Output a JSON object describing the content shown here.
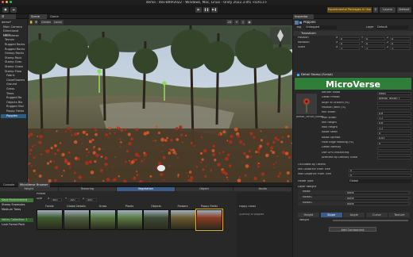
{
  "window": {
    "title": "demo - dev-BIRP2022 - Windows, Mac, Linux - Unity 2022.3.0f1 <DX11>"
  },
  "toolbar": {
    "experimental_label": "Experimental Packages In Use",
    "layers_label": "Layers",
    "layout_label": "Default"
  },
  "hierarchy": {
    "tab": "",
    "items": [
      "demo*",
      "Main Camera",
      "Directional Light",
      "MicroVerse",
      "Terrain",
      "Rugged Rocks",
      "Rugged Rocks",
      "Grassy Rocks",
      "Stamp Rock",
      "Stamp Gras",
      "Stamp Grass",
      "Stamp Flow",
      "Fabric",
      "ClearFlowers",
      "Ground",
      "Grass",
      "Trees",
      "Rugged Ro",
      "Objects Blo",
      "Rugged Stal",
      "Poppy Fields",
      "Poppies"
    ],
    "selected_index": 21
  },
  "scene": {
    "tabs": [
      "Scene",
      "Game"
    ],
    "toolbar_items": [
      "Center",
      "Local"
    ]
  },
  "inspector": {
    "tab": "Inspector",
    "object_name": "Poppies",
    "tag_label": "Tag",
    "tag_value": "Untagged",
    "layer_label": "Layer",
    "layer_value": "Default",
    "transform_header": "Transform",
    "position_label": "Position",
    "rotation_label": "Rotation",
    "scale_label": "Scale",
    "x": "X",
    "y": "Y",
    "z": "Z",
    "position": [
      "0",
      "0",
      "0"
    ],
    "rotation": [
      "0",
      "0",
      "0"
    ],
    "scale": [
      "1",
      "1",
      "1"
    ],
    "component_header": "Detail Stamp (Script)",
    "logo_text": "MicroVerse",
    "prefab_name": "prefab_Terrain_flower...",
    "props": [
      {
        "label": "Render Mode",
        "value": "Mesh"
      },
      {
        "label": "Detail Prefab",
        "value": "prefab_Terrain_f"
      },
      {
        "label": "Align To Ground (%)",
        "value": ""
      },
      {
        "label": "Position Jitter (%)",
        "value": ""
      },
      {
        "label": "Min Width",
        "value": "0.8"
      },
      {
        "label": "Max Width",
        "value": "1.2"
      },
      {
        "label": "Min Height",
        "value": "0.8"
      },
      {
        "label": "Max Height",
        "value": "1.2"
      },
      {
        "label": "Noise Seed",
        "value": "0"
      },
      {
        "label": "Noise Spread",
        "value": "0.03"
      },
      {
        "label": "Hole Edge Padding (%)",
        "value": "0"
      },
      {
        "label": "Detail density",
        "value": ""
      },
      {
        "label": "Use GPU Instancing",
        "value": ""
      },
      {
        "label": "Affected by Density Scale",
        "value": ""
      }
    ],
    "occlusion_header": "Occluded By Others",
    "occ_props": [
      {
        "label": "Min Distance From Tree",
        "value": "0"
      },
      {
        "label": "Max Distance From Tree",
        "value": "0"
      }
    ],
    "falloff_label": "Falloff Type",
    "falloff_value": "Global",
    "layer_weight_label": "Layer Weight",
    "noise_rows": [
      {
        "label": "Noise",
        "value": "None"
      },
      {
        "label": "Noise1",
        "value": "None"
      },
      {
        "label": "Noise1",
        "value": "None"
      }
    ],
    "filter_tabs": [
      "Height",
      "Slope",
      "Angle",
      "Curve",
      "Texture"
    ],
    "filter_active": 1,
    "weight_label": "Weight",
    "add_component": "Add Component"
  },
  "bottom": {
    "tabs": [
      "Console",
      "MicroVerse Browser"
    ],
    "tools": [
      "Height",
      "Texturing",
      "Vegetation",
      "Object",
      "Audio"
    ],
    "active_tool": 2,
    "preset_label": "Preset",
    "size_row": [
      "Size",
      "X",
      "500",
      "Y",
      "100",
      "Z",
      "500"
    ],
    "left_items": [
      "Save Environment",
      "Stamp Examples",
      "Medium Trees",
      "",
      "Valley Collection 1",
      "Lush Forest Pack"
    ],
    "categories": [
      "Forest",
      "Global Details",
      "Grass",
      "Plants",
      "Objects",
      "Flowers",
      "Poppy Fields"
    ],
    "right_labels": [
      "Poppy Fields",
      "Quantity of poppies"
    ]
  },
  "colors": {
    "selection": "#2c5d87",
    "accent_green": "#6fbf5a",
    "active_tool": "#3b5c88"
  }
}
